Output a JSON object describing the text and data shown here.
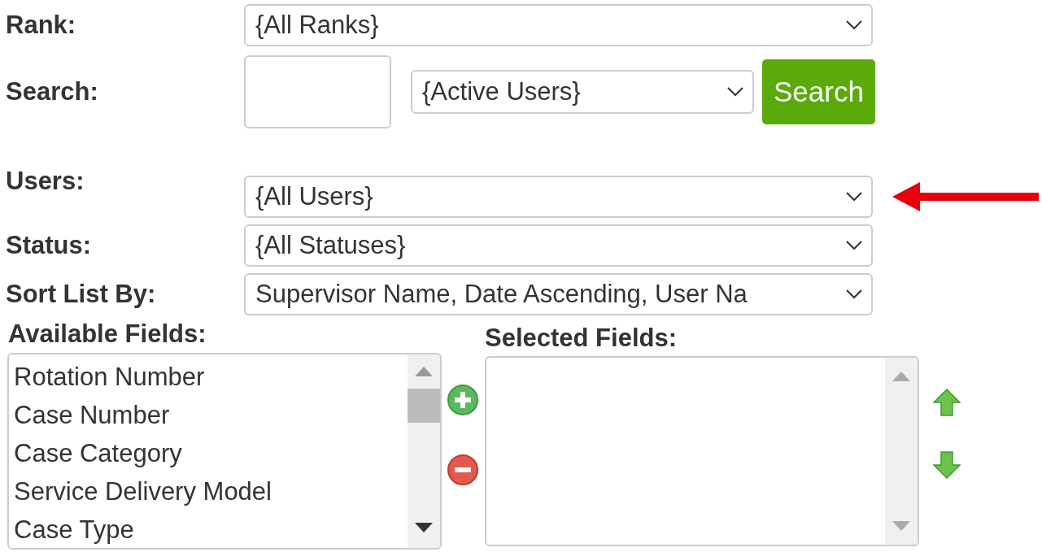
{
  "rank": {
    "label": "Rank:",
    "value": "{All Ranks}"
  },
  "search": {
    "label": "Search:",
    "scope": "{Active Users}",
    "button": "Search"
  },
  "users": {
    "label": "Users:",
    "value": "{All Users}"
  },
  "status": {
    "label": "Status:",
    "value": "{All Statuses}"
  },
  "sort_by": {
    "label": "Sort List By:",
    "value": "Supervisor Name, Date Ascending, User Na"
  },
  "available_fields": {
    "label": "Available Fields:",
    "items": [
      "Rotation Number",
      "Case Number",
      "Case Category",
      "Service Delivery Model",
      "Case Type"
    ]
  },
  "selected_fields": {
    "label": "Selected Fields:"
  }
}
